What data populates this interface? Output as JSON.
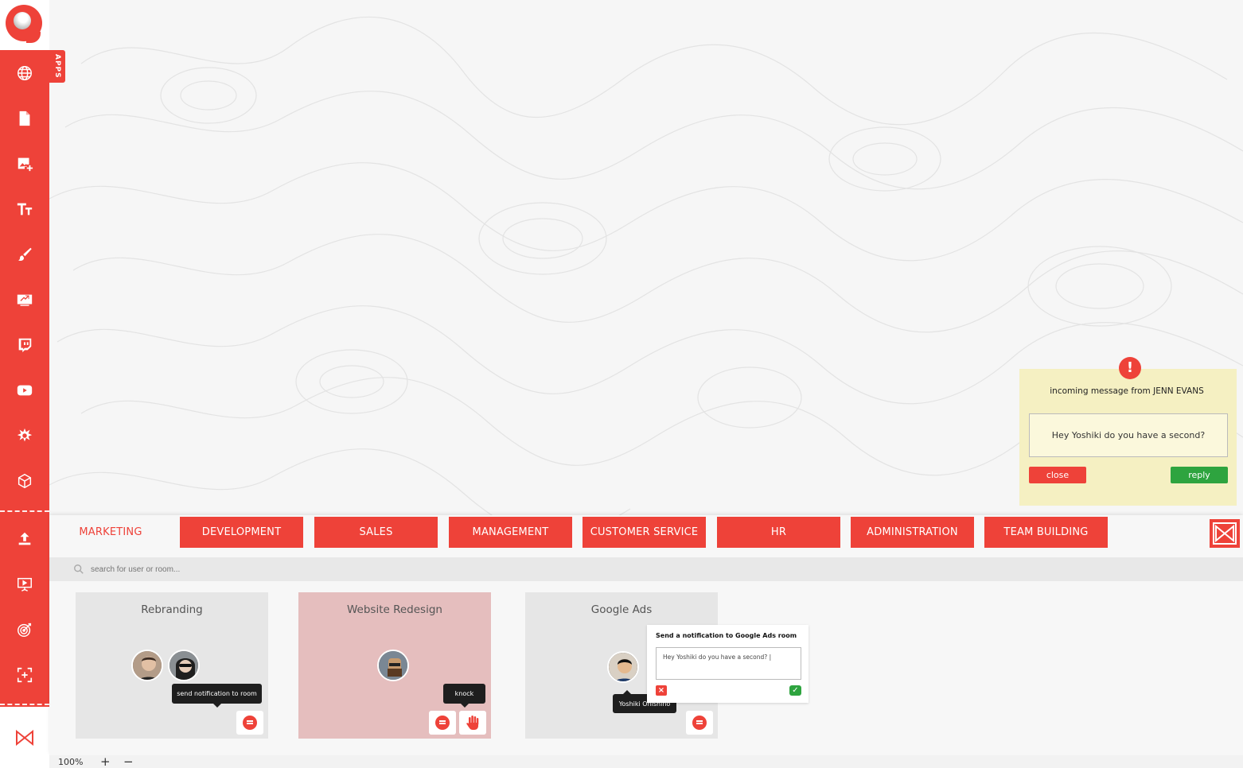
{
  "sidebar": {
    "apps_label": "APPS",
    "items": [
      {
        "icon": "globe-icon"
      },
      {
        "icon": "document-icon"
      },
      {
        "icon": "add-image-icon"
      },
      {
        "icon": "text-icon"
      },
      {
        "icon": "brush-icon"
      },
      {
        "icon": "screen-share-icon"
      },
      {
        "icon": "twitch-icon"
      },
      {
        "icon": "youtube-icon"
      },
      {
        "icon": "star-burst-icon"
      },
      {
        "icon": "cube-icon"
      },
      {
        "icon": "upload-icon"
      },
      {
        "icon": "presentation-icon"
      },
      {
        "icon": "target-icon"
      },
      {
        "icon": "add-frame-icon"
      }
    ]
  },
  "incoming_message": {
    "title": "incoming message from JENN EVANS",
    "message": "Hey Yoshiki do you have a second?",
    "close_label": "close",
    "reply_label": "reply"
  },
  "tabs": [
    {
      "label": "MARKETING",
      "active": true
    },
    {
      "label": "DEVELOPMENT"
    },
    {
      "label": "SALES"
    },
    {
      "label": "MANAGEMENT"
    },
    {
      "label": "CUSTOMER SERVICE"
    },
    {
      "label": "HR"
    },
    {
      "label": "ADMINISTRATION"
    },
    {
      "label": "TEAM BUILDING"
    }
  ],
  "search": {
    "placeholder": "search for user or room..."
  },
  "rooms": [
    {
      "name": "Rebranding",
      "tooltip": "send notification to room"
    },
    {
      "name": "Website Redesign",
      "tooltip": "knock"
    },
    {
      "name": "Google Ads",
      "user_tooltip": "Yoshiki Onishino"
    }
  ],
  "notify_popup": {
    "title": "Send a notification to Google Ads room",
    "message": "Hey Yoshiki do you have a second?  |"
  },
  "zoom": {
    "level": "100%",
    "plus": "+",
    "minus": "−"
  },
  "colors": {
    "accent": "#ee4239",
    "success": "#2ea43f",
    "highlight_room": "#e5bebe",
    "message_panel": "#f5f0c2"
  }
}
